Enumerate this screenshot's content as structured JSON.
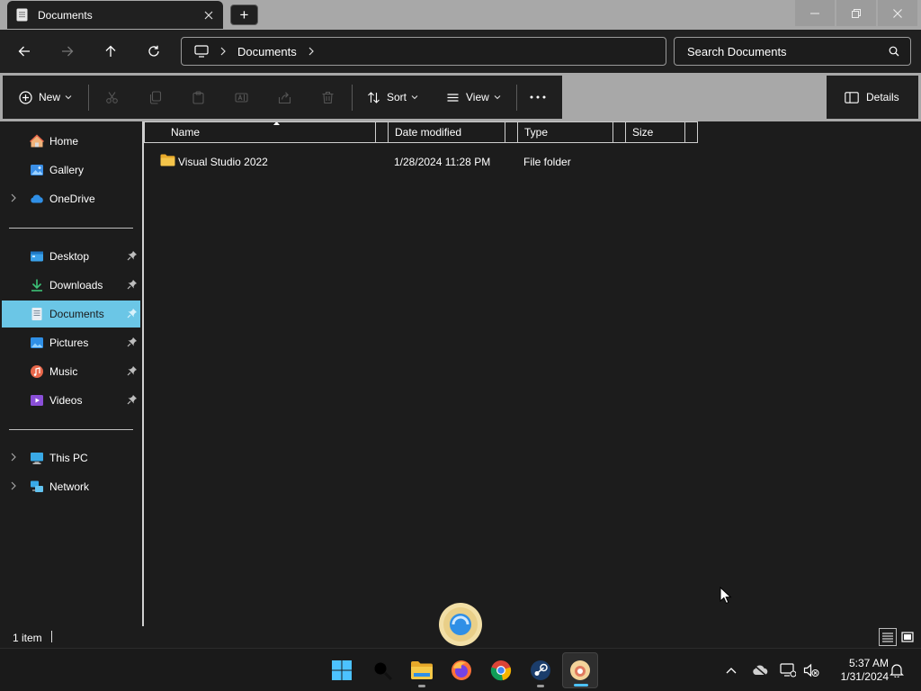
{
  "window": {
    "tab_title": "Documents",
    "new_tab_label": "+"
  },
  "address": {
    "crumbs": [
      "Documents"
    ],
    "search_placeholder": "Search Documents"
  },
  "command_bar": {
    "new_label": "New",
    "sort_label": "Sort",
    "view_label": "View",
    "details_label": "Details"
  },
  "sidebar": {
    "top": [
      {
        "label": "Home",
        "icon": "home-icon"
      },
      {
        "label": "Gallery",
        "icon": "gallery-icon"
      },
      {
        "label": "OneDrive",
        "icon": "onedrive-icon"
      }
    ],
    "quick": [
      {
        "label": "Desktop",
        "icon": "desktop-icon"
      },
      {
        "label": "Downloads",
        "icon": "downloads-icon"
      },
      {
        "label": "Documents",
        "icon": "documents-icon",
        "selected": true
      },
      {
        "label": "Pictures",
        "icon": "pictures-icon"
      },
      {
        "label": "Music",
        "icon": "music-icon"
      },
      {
        "label": "Videos",
        "icon": "videos-icon"
      }
    ],
    "bottom": [
      {
        "label": "This PC",
        "icon": "this-pc-icon"
      },
      {
        "label": "Network",
        "icon": "network-icon"
      }
    ]
  },
  "file_list": {
    "columns": [
      "Name",
      "Date modified",
      "Type",
      "Size"
    ],
    "rows": [
      {
        "name": "Visual Studio 2022",
        "date_modified": "1/28/2024 11:28 PM",
        "type": "File folder",
        "size": ""
      }
    ]
  },
  "status": {
    "item_count": "1 item"
  },
  "taskbar": {
    "time": "5:37 AM",
    "date": "1/31/2024"
  },
  "colors": {
    "accent": "#4cc2ff",
    "selected_bg": "#6bc6e6",
    "folder": "#f4c44a"
  }
}
